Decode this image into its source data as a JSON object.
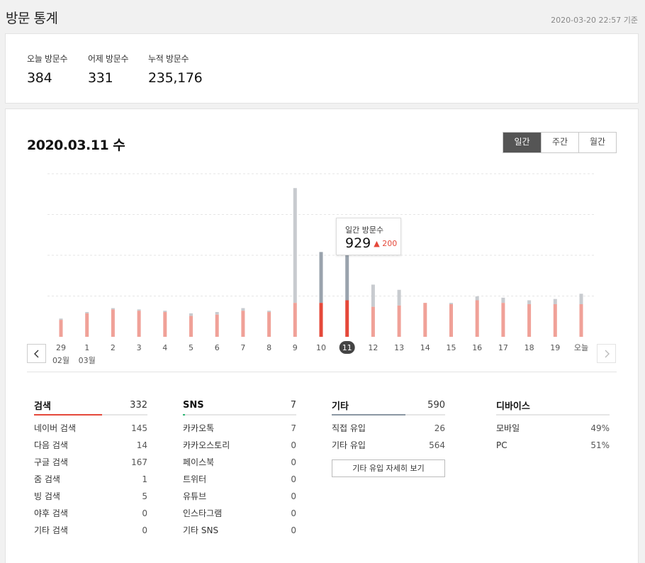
{
  "page_title": "방문 통계",
  "timestamp": "2020-03-20 22:57 기준",
  "summary": [
    {
      "label": "오늘 방문수",
      "value": "384"
    },
    {
      "label": "어제 방문수",
      "value": "331"
    },
    {
      "label": "누적 방문수",
      "value": "235,176"
    }
  ],
  "date_title": "2020.03.11 수",
  "period_tabs": [
    "일간",
    "주간",
    "월간"
  ],
  "active_period": 0,
  "tooltip": {
    "label": "일간 방문수",
    "value": "929",
    "change": "200"
  },
  "colors": {
    "accent": "#e5483a",
    "bar_light": "#f0a198",
    "bar_gray": "#c8cbcf",
    "bar_gray_dark": "#9aa3ad",
    "sns_green": "#2bb673",
    "etc_gray": "#8b97a3"
  },
  "nav_icons": {
    "prev": "chevron-left-icon",
    "next": "chevron-right-icon"
  },
  "chart_data": {
    "type": "bar",
    "categories": [
      "29",
      "1",
      "2",
      "3",
      "4",
      "5",
      "6",
      "7",
      "8",
      "9",
      "10",
      "11",
      "12",
      "13",
      "14",
      "15",
      "16",
      "17",
      "18",
      "19",
      "오늘"
    ],
    "month_labels": [
      {
        "index": 0,
        "label": "02월"
      },
      {
        "index": 1,
        "label": "03월"
      }
    ],
    "selected_index": 11,
    "ylim": [
      0,
      1250
    ],
    "series": [
      {
        "values": [
          130,
          180,
          210,
          200,
          190,
          160,
          170,
          200,
          190,
          260,
          260,
          280,
          230,
          240,
          260,
          250,
          280,
          260,
          250,
          250,
          250
        ]
      },
      {
        "values": [
          140,
          190,
          220,
          210,
          200,
          180,
          190,
          220,
          200,
          1140,
          650,
          830,
          400,
          360,
          260,
          260,
          310,
          300,
          280,
          290,
          330
        ]
      }
    ]
  },
  "categories": [
    {
      "title": "검색",
      "total": "332",
      "fill": 0.6,
      "color": "#e5483a",
      "rows": [
        [
          "네이버 검색",
          "145"
        ],
        [
          "다음 검색",
          "14"
        ],
        [
          "구글 검색",
          "167"
        ],
        [
          "줌 검색",
          "1"
        ],
        [
          "빙 검색",
          "5"
        ],
        [
          "야후 검색",
          "0"
        ],
        [
          "기타 검색",
          "0"
        ]
      ]
    },
    {
      "title": "SNS",
      "total": "7",
      "fill": 0.02,
      "color": "#2bb673",
      "rows": [
        [
          "카카오톡",
          "7"
        ],
        [
          "카카오스토리",
          "0"
        ],
        [
          "페이스북",
          "0"
        ],
        [
          "트위터",
          "0"
        ],
        [
          "유튜브",
          "0"
        ],
        [
          "인스타그램",
          "0"
        ],
        [
          "기타 SNS",
          "0"
        ]
      ]
    },
    {
      "title": "기타",
      "total": "590",
      "fill": 0.65,
      "color": "#8b97a3",
      "rows": [
        [
          "직접 유입",
          "26"
        ],
        [
          "기타 유입",
          "564"
        ]
      ],
      "button": "기타 유입 자세히 보기"
    },
    {
      "title": "디바이스",
      "total": "",
      "fill": 0,
      "color": "#e5483a",
      "rows": [
        [
          "모바일",
          "49%"
        ],
        [
          "PC",
          "51%"
        ]
      ]
    }
  ]
}
